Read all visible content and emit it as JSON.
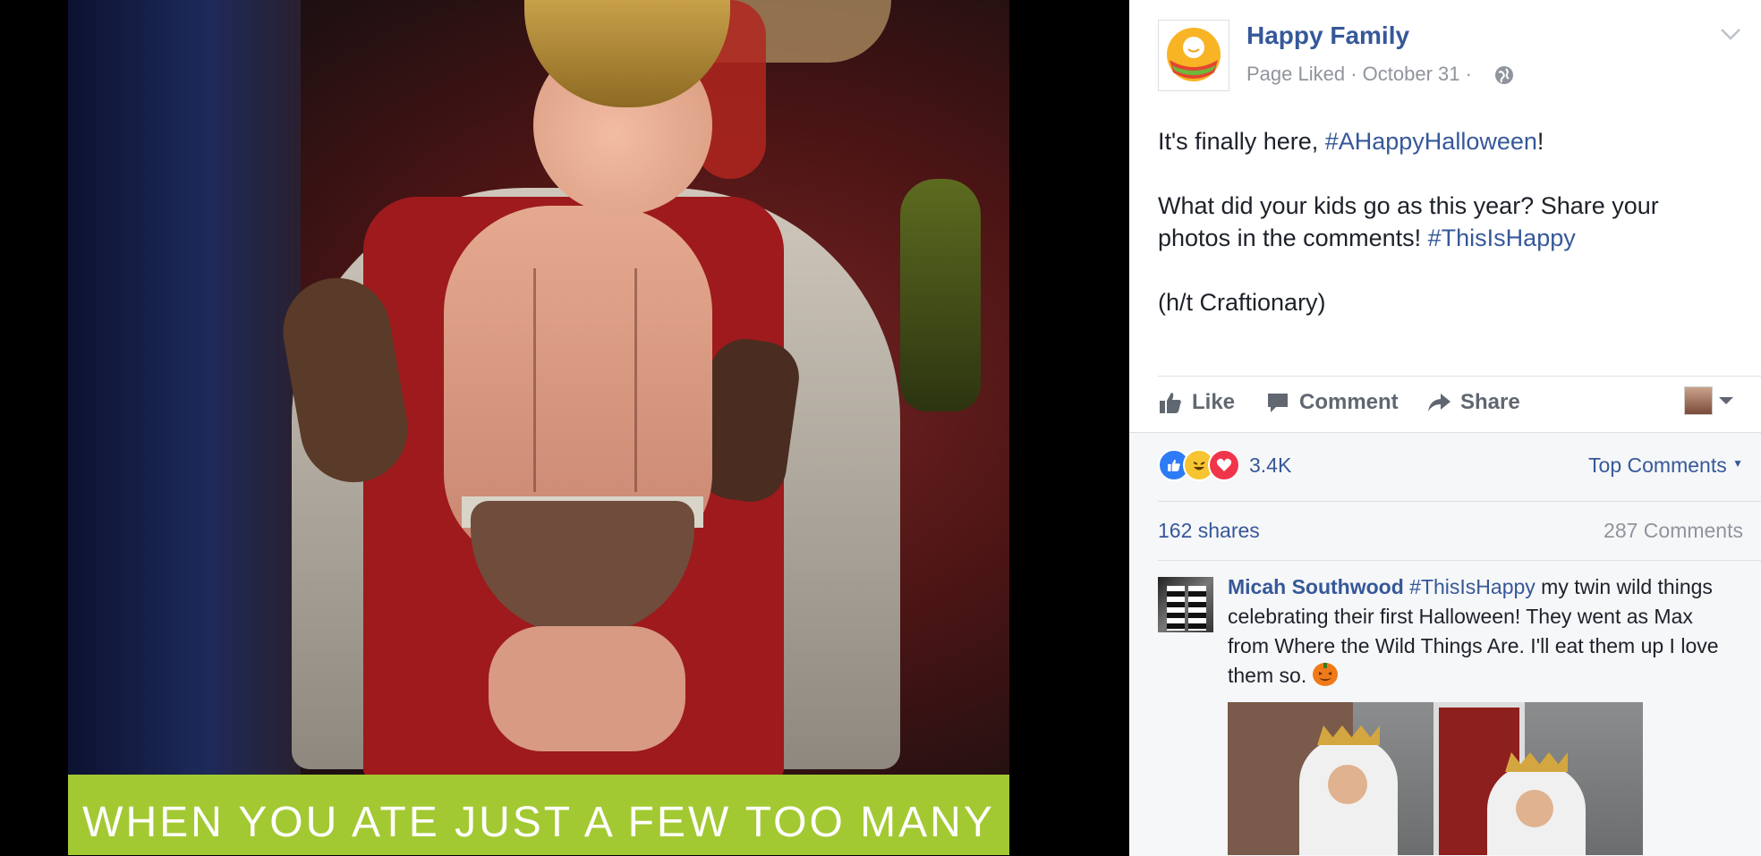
{
  "photo": {
    "caption": "WHEN YOU ATE JUST A FEW TOO MANY",
    "caption_band_color": "#a2c932"
  },
  "post": {
    "page_name": "Happy Family",
    "meta": "Page Liked · October 31 ·",
    "privacy_icon": "globe-icon",
    "text": {
      "line1_prefix": "It's finally here, ",
      "line1_tag": "#AHappyHalloween",
      "line1_suffix": "!",
      "para2": "What did your kids go as this year? Share your photos in the comments! ",
      "para2_tag": "#ThisIsHappy",
      "para3": "(h/t Craftionary)"
    },
    "actions": {
      "like": "Like",
      "comment": "Comment",
      "share": "Share"
    },
    "reactions": {
      "count": "3.4K",
      "icons": [
        "like-reaction-icon",
        "haha-reaction-icon",
        "love-reaction-icon"
      ]
    },
    "sort_label": "Top Comments",
    "shares": "162 shares",
    "comments_count": "287 Comments",
    "comment": {
      "author": "Micah Southwood",
      "tag": "#ThisIsHappy",
      "text": " my twin wild things celebrating their first Halloween! They went as Max from Where the Wild Things Are. I'll eat them up I love them so. ",
      "emoji": "jack-o-lantern-icon"
    }
  },
  "colors": {
    "link": "#365899",
    "meta": "#90949c",
    "text": "#1d2129"
  }
}
